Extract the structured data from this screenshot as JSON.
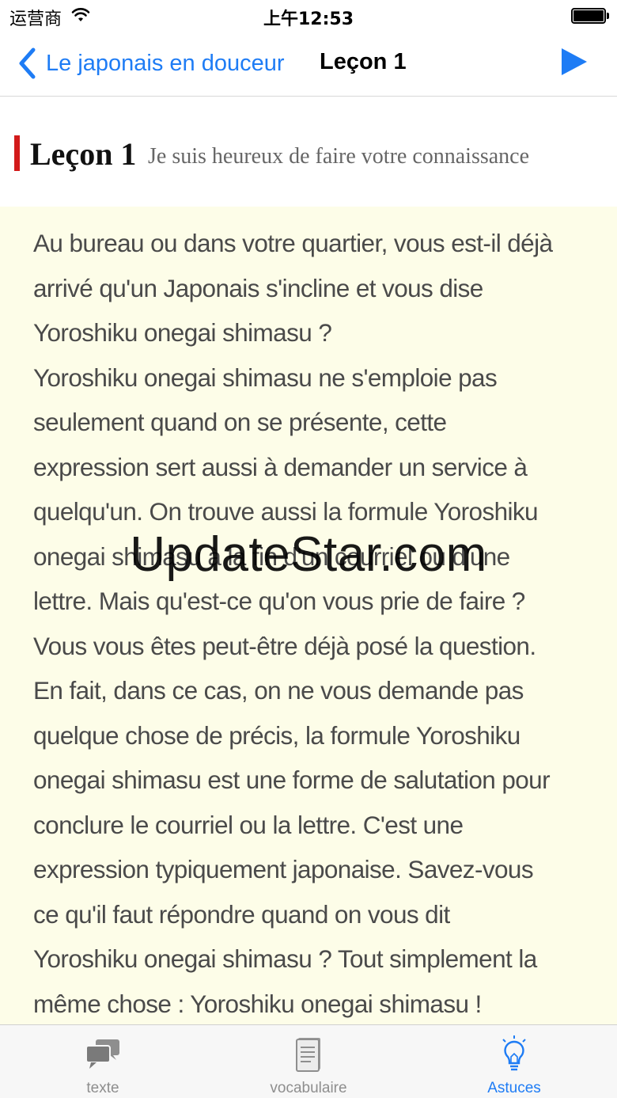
{
  "status_bar": {
    "carrier": "运营商",
    "time": "上午12:53",
    "icons": [
      "wifi-icon",
      "battery-icon"
    ]
  },
  "nav": {
    "back_label": "Le japonais en douceur",
    "title": "Leçon 1",
    "icons": {
      "back": "chevron-left-icon",
      "play": "play-icon"
    },
    "accent_color": "#1e7cf5"
  },
  "lesson": {
    "title": "Leçon 1",
    "subtitle": "Je suis heureux de faire votre connaissance",
    "marker_color": "#d21a1a"
  },
  "content": {
    "lines": [
      "Au bureau ou dans votre quartier, vous est-il déjà",
      "arrivé qu'un Japonais s'incline et vous dise",
      "Yoroshiku onegai shimasu ?",
      "Yoroshiku onegai shimasu ne s'emploie pas",
      "seulement quand on se présente, cette",
      "expression sert aussi à demander un service à",
      "quelqu'un. On trouve aussi la formule Yoroshiku",
      "onegai shimasu à la fin d'un courriel ou d'une",
      "lettre. Mais qu'est-ce qu'on vous prie de faire ?",
      "Vous vous êtes peut-être déjà posé la question.",
      "En fait, dans ce cas, on ne vous demande pas",
      "quelque chose de précis, la formule Yoroshiku",
      "onegai shimasu est une forme de salutation pour",
      "conclure le courriel ou la lettre. C'est une",
      "expression typiquement japonaise. Savez-vous",
      "ce qu'il faut répondre quand on vous dit",
      "Yoroshiku onegai shimasu ? Tout simplement la",
      "même chose : Yoroshiku onegai shimasu !"
    ],
    "background_color": "#fdfde8"
  },
  "watermark": "UpdateStar.com",
  "tabs": [
    {
      "label": "texte",
      "icon": "speech-bubbles-icon",
      "active": false
    },
    {
      "label": "vocabulaire",
      "icon": "document-icon",
      "active": false
    },
    {
      "label": "Astuces",
      "icon": "lightbulb-icon",
      "active": true
    }
  ]
}
